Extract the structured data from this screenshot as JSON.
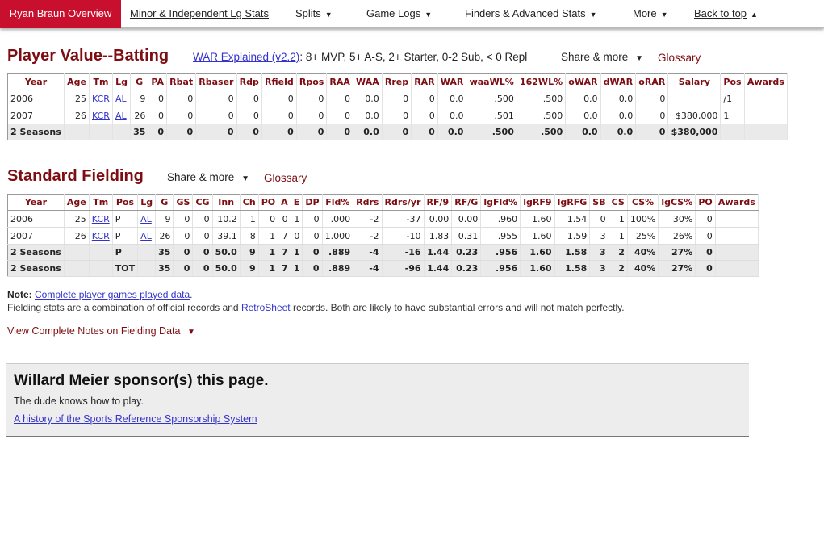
{
  "nav": {
    "items": [
      {
        "label": "Ryan Braun Overview",
        "caret": ""
      },
      {
        "label": "Minor & Independent Lg Stats",
        "caret": ""
      },
      {
        "label": "Splits",
        "caret": "▼"
      },
      {
        "label": "Game Logs",
        "caret": "▼"
      },
      {
        "label": "Finders & Advanced Stats",
        "caret": "▼"
      },
      {
        "label": "More",
        "caret": "▼"
      },
      {
        "label": "Back to top",
        "caret": "▲"
      }
    ]
  },
  "batting": {
    "title": "Player Value--Batting",
    "war_link": "WAR Explained (v2.2)",
    "war_legend": ": 8+ MVP, 5+ A-S, 2+ Starter, 0-2 Sub, < 0 Repl",
    "share_label": "Share & more",
    "share_caret": "▼",
    "glossary_label": "Glossary",
    "columns": [
      "Year",
      "Age",
      "Tm",
      "Lg",
      "G",
      "PA",
      "Rbat",
      "Rbaser",
      "Rdp",
      "Rfield",
      "Rpos",
      "RAA",
      "WAA",
      "Rrep",
      "RAR",
      "WAR",
      "waaWL%",
      "162WL%",
      "oWAR",
      "dWAR",
      "oRAR",
      "Salary",
      "Pos",
      "Awards"
    ],
    "rows": [
      [
        "2006",
        "25",
        "KCR",
        "AL",
        "9",
        "0",
        "0",
        "0",
        "0",
        "0",
        "0",
        "0",
        "0.0",
        "0",
        "0",
        "0.0",
        ".500",
        ".500",
        "0.0",
        "0.0",
        "0",
        "",
        "/1",
        ""
      ],
      [
        "2007",
        "26",
        "KCR",
        "AL",
        "26",
        "0",
        "0",
        "0",
        "0",
        "0",
        "0",
        "0",
        "0.0",
        "0",
        "0",
        "0.0",
        ".501",
        ".500",
        "0.0",
        "0.0",
        "0",
        "$380,000",
        "1",
        ""
      ]
    ],
    "total": [
      "2 Seasons",
      "",
      "",
      "",
      "35",
      "0",
      "0",
      "0",
      "0",
      "0",
      "0",
      "0",
      "0.0",
      "0",
      "0",
      "0.0",
      ".500",
      ".500",
      "0.0",
      "0.0",
      "0",
      "$380,000",
      "",
      ""
    ]
  },
  "fielding": {
    "title": "Standard Fielding",
    "share_label": "Share & more",
    "share_caret": "▼",
    "glossary_label": "Glossary",
    "columns": [
      "Year",
      "Age",
      "Tm",
      "Pos",
      "Lg",
      "G",
      "GS",
      "CG",
      "Inn",
      "Ch",
      "PO",
      "A",
      "E",
      "DP",
      "Fld%",
      "Rdrs",
      "Rdrs/yr",
      "RF/9",
      "RF/G",
      "lgFld%",
      "lgRF9",
      "lgRFG",
      "SB",
      "CS",
      "CS%",
      "lgCS%",
      "PO",
      "Awards"
    ],
    "rows": [
      [
        "2006",
        "25",
        "KCR",
        "P",
        "AL",
        "9",
        "0",
        "0",
        "10.2",
        "1",
        "0",
        "0",
        "1",
        "0",
        ".000",
        "-2",
        "-37",
        "0.00",
        "0.00",
        ".960",
        "1.60",
        "1.54",
        "0",
        "1",
        "100%",
        "30%",
        "0",
        ""
      ],
      [
        "2007",
        "26",
        "KCR",
        "P",
        "AL",
        "26",
        "0",
        "0",
        "39.1",
        "8",
        "1",
        "7",
        "0",
        "0",
        "1.000",
        "-2",
        "-10",
        "1.83",
        "0.31",
        ".955",
        "1.60",
        "1.59",
        "3",
        "1",
        "25%",
        "26%",
        "0",
        ""
      ]
    ],
    "totals": [
      [
        "2 Seasons",
        "",
        "",
        "P",
        "",
        "35",
        "0",
        "0",
        "50.0",
        "9",
        "1",
        "7",
        "1",
        "0",
        ".889",
        "-4",
        "-16",
        "1.44",
        "0.23",
        ".956",
        "1.60",
        "1.58",
        "3",
        "2",
        "40%",
        "27%",
        "0",
        ""
      ],
      [
        "2 Seasons",
        "",
        "",
        "TOT",
        "",
        "35",
        "0",
        "0",
        "50.0",
        "9",
        "1",
        "7",
        "1",
        "0",
        ".889",
        "-4",
        "-96",
        "1.44",
        "0.23",
        ".956",
        "1.60",
        "1.58",
        "3",
        "2",
        "40%",
        "27%",
        "0",
        ""
      ]
    ]
  },
  "notes": {
    "note_label": "Note:",
    "note_link": "Complete player games played data",
    "note_period": ".",
    "fielding_pre": "Fielding stats are a combination of official records and ",
    "retrosheet_link": "RetroSheet",
    "fielding_post": " records. Both are likely to have substantial errors and will not match perfectly.",
    "view_notes": "View Complete Notes on Fielding Data",
    "view_caret": "▼"
  },
  "sponsor": {
    "title": "Willard Meier sponsor(s) this page.",
    "body": "The dude knows how to play.",
    "link": "A history of the Sports Reference Sponsorship System"
  },
  "colors": {
    "brand_red": "#c8102e",
    "heading_red": "#7d0d12",
    "link_blue": "#3333cc"
  }
}
